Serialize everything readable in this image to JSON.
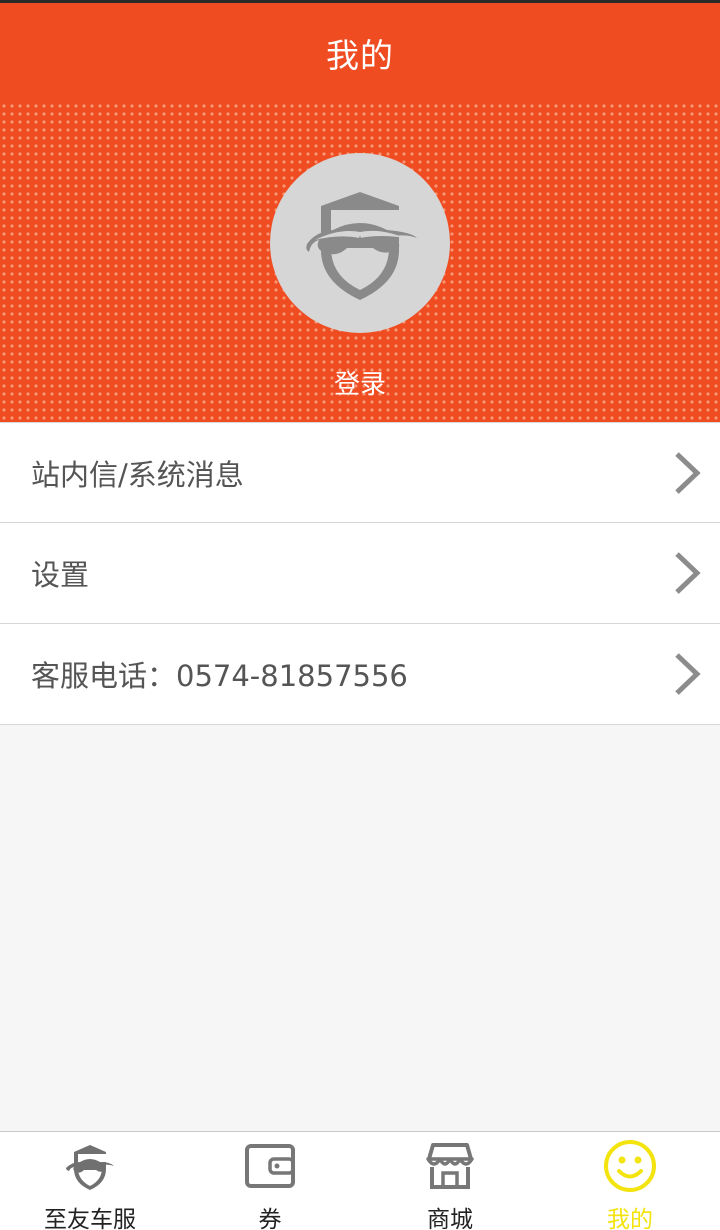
{
  "header": {
    "title": "我的"
  },
  "profile": {
    "login_label": "登录"
  },
  "menu": {
    "items": [
      {
        "label": "站内信/系统消息"
      },
      {
        "label": "设置"
      },
      {
        "label": "客服电话：0574-81857556"
      }
    ]
  },
  "tabbar": {
    "items": [
      {
        "label": "至友车服",
        "icon": "car-shield-icon"
      },
      {
        "label": "券",
        "icon": "coupon-icon"
      },
      {
        "label": "商城",
        "icon": "store-icon"
      },
      {
        "label": "我的",
        "icon": "smiley-icon",
        "active": true
      }
    ]
  },
  "colors": {
    "brand": "#ef4c22",
    "active_tab": "#f3e30f",
    "text": "#555555"
  }
}
